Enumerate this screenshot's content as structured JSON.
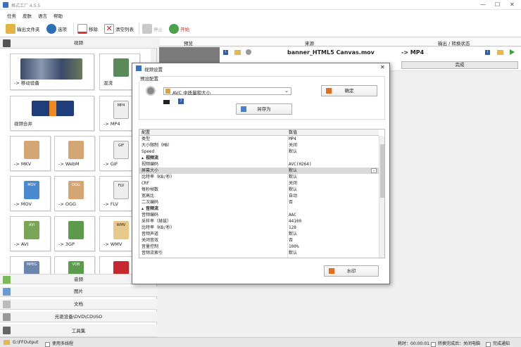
{
  "app": {
    "title": "格式工厂 4.5.5"
  },
  "menu": [
    "任务",
    "皮肤",
    "语言",
    "帮助"
  ],
  "toolbar": {
    "output_folder": "输出文件夹",
    "options": "选项",
    "remove": "移除",
    "clear_list": "清空列表",
    "stop": "停止",
    "start": "开始"
  },
  "left": {
    "video_header": "视频",
    "tiles": [
      "-> 移动设备",
      "混流",
      "视频合并",
      "-> MP4",
      "-> MKV",
      "-> WebM",
      "-> GIF",
      "-> MOV",
      "-> OGG",
      "-> FLV",
      "-> AVI",
      "-> 3GP",
      "-> WMV"
    ],
    "thumb_labels": [
      "MP4",
      "GIF",
      "MOV",
      "OGG",
      "FLV",
      "AVI",
      "WMV",
      "MPEG",
      "VOB"
    ],
    "categories": [
      "音频",
      "图片",
      "文档",
      "光驱设备\\DVD\\CD\\ISO",
      "工具集"
    ]
  },
  "task_list": {
    "col_preview": "预览",
    "col_source": "来源",
    "col_output": "输出 / 转换状态",
    "file_name": "banner_HTML5 Canvas.mov",
    "output_format": "-> MP4",
    "status": "完成"
  },
  "dialog": {
    "title": "视频设置",
    "preset_label": "预设配置",
    "preset_value": "AVC 中质量和大小",
    "ok": "确定",
    "save_as": "另存为",
    "col_config": "配置",
    "col_value": "数值",
    "rows": [
      {
        "k": "类型",
        "v": "MP4"
      },
      {
        "k": "大小限制（MB）",
        "v": "关闭"
      },
      {
        "k": "Speed",
        "v": "默认"
      },
      {
        "k": "视频流",
        "v": "",
        "section": true
      },
      {
        "k": "视频编码",
        "v": "AVC(H264)"
      },
      {
        "k": "屏幕大小",
        "v": "默认",
        "selected": true
      },
      {
        "k": "比特率（KB/秒）",
        "v": "默认"
      },
      {
        "k": "CRF",
        "v": "关闭"
      },
      {
        "k": "每秒帧数",
        "v": "默认"
      },
      {
        "k": "宽高比",
        "v": "自动"
      },
      {
        "k": "二次编码",
        "v": "否"
      },
      {
        "k": "音频流",
        "v": "",
        "section": true
      },
      {
        "k": "音频编码",
        "v": "AAC"
      },
      {
        "k": "采样率（赫兹）",
        "v": "44100"
      },
      {
        "k": "比特率（KB/秒）",
        "v": "128"
      },
      {
        "k": "音频声道",
        "v": "默认"
      },
      {
        "k": "关闭音效",
        "v": "否"
      },
      {
        "k": "音量控制",
        "v": "100%"
      },
      {
        "k": "音频流索引",
        "v": "默认"
      }
    ],
    "watermark": "水印"
  },
  "status_bar": {
    "output_path": "G:\\FFOutput",
    "multithread": "使用多线程",
    "elapsed": "耗时：00:00:01",
    "after_convert": "转换完成后：关闭电脑",
    "notify": "完成通知"
  }
}
